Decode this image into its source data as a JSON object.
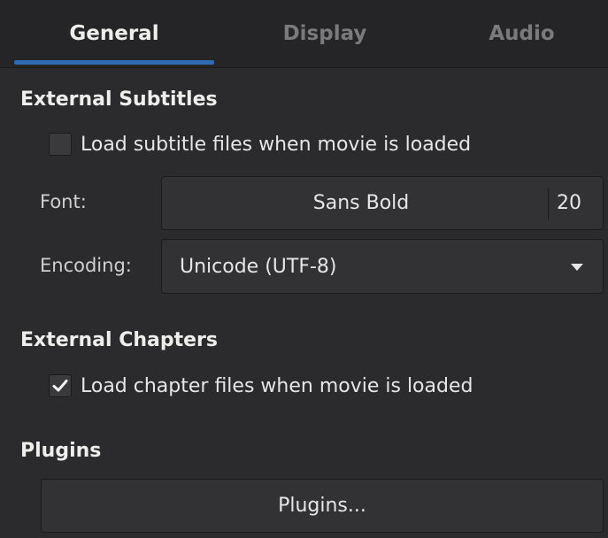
{
  "tabs": [
    {
      "label": "General",
      "active": true
    },
    {
      "label": "Display",
      "active": false
    },
    {
      "label": "Audio",
      "active": false
    }
  ],
  "subtitles": {
    "section_title": "External Subtitles",
    "load_checkbox_label": "Load subtitle files when movie is loaded",
    "load_checked": false,
    "font_label": "Font:",
    "font_name": "Sans Bold",
    "font_size": "20",
    "encoding_label": "Encoding:",
    "encoding_value": "Unicode (UTF-8)"
  },
  "chapters": {
    "section_title": "External Chapters",
    "load_checkbox_label": "Load chapter files when movie is loaded",
    "load_checked": true
  },
  "plugins": {
    "section_title": "Plugins",
    "button_label": "Plugins..."
  },
  "icons": {
    "checkmark": "checkmark-icon",
    "dropdown": "triangle-down-icon"
  },
  "colors": {
    "background": "#2b2b2d",
    "tab_accent": "#2f6bb3",
    "button_bg": "#323234"
  }
}
